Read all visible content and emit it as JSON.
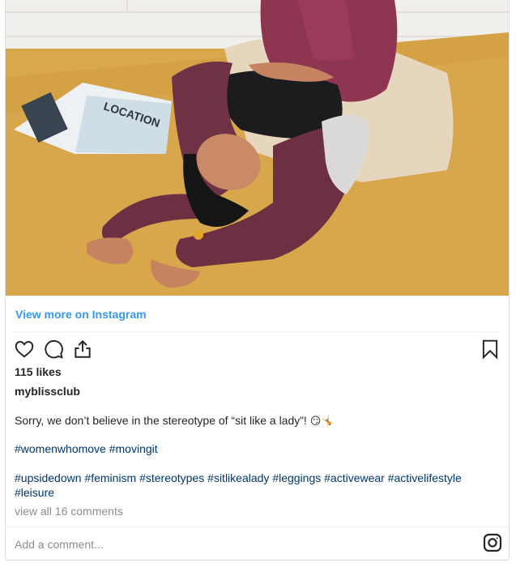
{
  "post": {
    "view_more_label": "View more on Instagram",
    "likes": "115 likes",
    "username": "myblissclub",
    "caption": "Sorry, we don’t believe in the stereotype of “sit like a lady”!",
    "caption_emoji": "😏🤸",
    "hashtags_line1": [
      "#womenwhomove",
      "#movingit"
    ],
    "hashtags_line2": [
      "#upsidedown",
      "#feminism",
      "#stereotypes",
      "#sitlikealady",
      "#leggings",
      "#activewear",
      "#activelifestyle",
      "#leisure"
    ],
    "comments_link": "view all 16 comments",
    "add_comment_placeholder": "Add a comment...",
    "photo": {
      "magazine_text": "LOCATION"
    }
  },
  "icons": {
    "like": "heart-icon",
    "comment": "comment-icon",
    "share": "share-icon",
    "save": "bookmark-icon",
    "instagram": "instagram-logo-icon"
  },
  "colors": {
    "link_blue": "#3897f0",
    "hashtag": "#00376b",
    "muted": "#8e8e8e",
    "rug": "#d9a84a"
  }
}
